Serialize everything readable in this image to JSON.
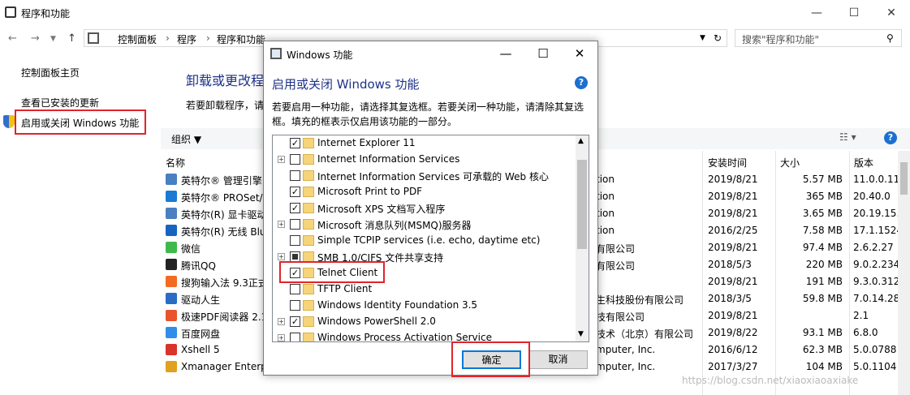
{
  "window": {
    "title": "程序和功能"
  },
  "address": {
    "crumbs": [
      "控制面板",
      "程序",
      "程序和功能"
    ],
    "search_placeholder": "搜索\"程序和功能\""
  },
  "left_nav": {
    "home": "控制面板主页",
    "updates": "查看已安装的更新",
    "features": "启用或关闭 Windows 功能"
  },
  "content": {
    "title": "卸载或更改程",
    "subtitle": "若要卸载程序，请"
  },
  "toolbar": {
    "organize": "组织 ▼"
  },
  "columns": {
    "name": "名称",
    "date": "安装时间",
    "size": "大小",
    "version": "版本"
  },
  "programs": [
    {
      "name": "英特尔® 管理引擎",
      "pub": "tion",
      "date": "2019/8/21",
      "size": "5.57 MB",
      "ver": "11.0.0.11",
      "color": "#4a7fc1"
    },
    {
      "name": "英特尔® PROSet/",
      "pub": "tion",
      "date": "2019/8/21",
      "size": "365 MB",
      "ver": "20.40.0",
      "color": "#1b7bd3"
    },
    {
      "name": "英特尔(R) 显卡驱动",
      "pub": "tion",
      "date": "2019/8/21",
      "size": "3.65 MB",
      "ver": "20.19.15.",
      "color": "#4a7fc1"
    },
    {
      "name": "英特尔(R) 无线 Blu",
      "pub": "tion",
      "date": "2016/2/25",
      "size": "7.58 MB",
      "ver": "17.1.1524",
      "color": "#1565c0"
    },
    {
      "name": "微信",
      "pub": "有限公司",
      "date": "2019/8/21",
      "size": "97.4 MB",
      "ver": "2.6.2.27",
      "color": "#3fb94a"
    },
    {
      "name": "腾讯QQ",
      "pub": "有限公司",
      "date": "2018/5/3",
      "size": "220 MB",
      "ver": "9.0.2.234",
      "color": "#222222"
    },
    {
      "name": "搜狗输入法 9.3正式",
      "pub": "",
      "date": "2019/8/21",
      "size": "191 MB",
      "ver": "9.3.0.312",
      "color": "#f36b21"
    },
    {
      "name": "驱动人生",
      "pub": "生科技股份有限公司",
      "date": "2018/3/5",
      "size": "59.8 MB",
      "ver": "7.0.14.28",
      "color": "#2b6cc4"
    },
    {
      "name": "极速PDF阅读器 2.1",
      "pub": "技有限公司",
      "date": "2019/8/21",
      "size": "",
      "ver": "2.1",
      "color": "#e8542b"
    },
    {
      "name": "百度网盘",
      "pub": "技术（北京）有限公司",
      "date": "2019/8/22",
      "size": "93.1 MB",
      "ver": "6.8.0",
      "color": "#2f8fe8"
    },
    {
      "name": "Xshell 5",
      "pub": "mputer, Inc.",
      "date": "2016/6/12",
      "size": "62.3 MB",
      "ver": "5.0.0788",
      "color": "#d9342b"
    },
    {
      "name": "Xmanager Enterp",
      "pub": "mputer, Inc.",
      "date": "2017/3/27",
      "size": "104 MB",
      "ver": "5.0.1104",
      "color": "#e0a020"
    }
  ],
  "dialog": {
    "title": "Windows 功能",
    "heading": "启用或关闭 Windows 功能",
    "description": "若要启用一种功能，请选择其复选框。若要关闭一种功能，请清除其复选框。填充的框表示仅启用该功能的一部分。",
    "features": [
      {
        "label": "Internet Explorer 11",
        "state": "checked",
        "expand": false
      },
      {
        "label": "Internet Information Services",
        "state": "unchecked",
        "expand": true
      },
      {
        "label": "Internet Information Services 可承载的 Web 核心",
        "state": "unchecked",
        "expand": false
      },
      {
        "label": "Microsoft Print to PDF",
        "state": "checked",
        "expand": false
      },
      {
        "label": "Microsoft XPS 文档写入程序",
        "state": "checked",
        "expand": false
      },
      {
        "label": "Microsoft 消息队列(MSMQ)服务器",
        "state": "unchecked",
        "expand": true
      },
      {
        "label": "Simple TCPIP services (i.e. echo, daytime etc)",
        "state": "unchecked",
        "expand": false
      },
      {
        "label": "SMB 1.0/CIFS 文件共享支持",
        "state": "partial",
        "expand": true
      },
      {
        "label": "Telnet Client",
        "state": "checked",
        "expand": false
      },
      {
        "label": "TFTP Client",
        "state": "unchecked",
        "expand": false
      },
      {
        "label": "Windows Identity Foundation 3.5",
        "state": "unchecked",
        "expand": false
      },
      {
        "label": "Windows PowerShell 2.0",
        "state": "checked",
        "expand": true
      },
      {
        "label": "Windows Process Activation Service",
        "state": "unchecked",
        "expand": true
      }
    ],
    "ok": "确定",
    "cancel": "取消"
  },
  "watermark": "https://blog.csdn.net/xiaoxiaoaxiake",
  "accent": "#e0242b"
}
